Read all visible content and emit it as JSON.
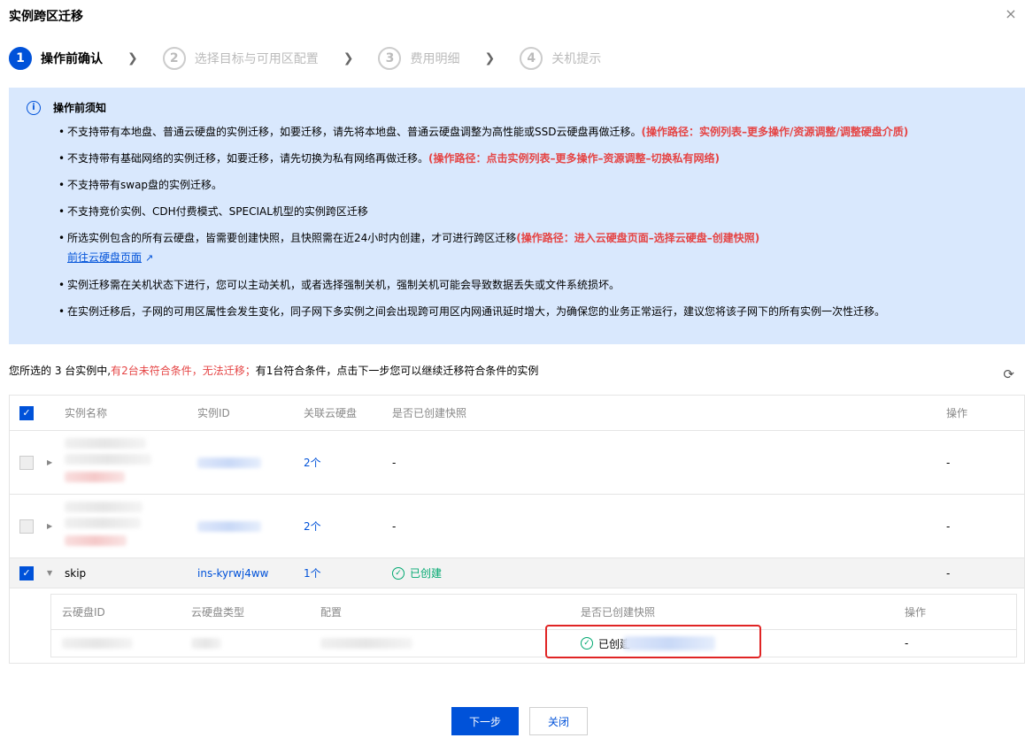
{
  "dialog": {
    "title": "实例跨区迁移",
    "close_icon": "×"
  },
  "steps": [
    {
      "num": "1",
      "label": "操作前确认"
    },
    {
      "num": "2",
      "label": "选择目标与可用区配置"
    },
    {
      "num": "3",
      "label": "费用明细"
    },
    {
      "num": "4",
      "label": "关机提示"
    }
  ],
  "notice": {
    "title": "操作前须知",
    "items": [
      {
        "text": "不支持带有本地盘、普通云硬盘的实例迁移，如要迁移，请先将本地盘、普通云硬盘调整为高性能或SSD云硬盘再做迁移。",
        "path": "(操作路径：实例列表–更多操作/资源调整/调整硬盘介质)"
      },
      {
        "text": "不支持带有基础网络的实例迁移，如要迁移，请先切换为私有网络再做迁移。",
        "path": "(操作路径：点击实例列表–更多操作–资源调整–切换私有网络)"
      },
      {
        "text": "不支持带有swap盘的实例迁移。",
        "path": ""
      },
      {
        "text": "不支持竞价实例、CDH付费模式、SPECIAL机型的实例跨区迁移",
        "path": ""
      },
      {
        "text": "所选实例包含的所有云硬盘，皆需要创建快照，且快照需在近24小时内创建，才可进行跨区迁移",
        "path": "(操作路径：进入云硬盘页面–选择云硬盘–创建快照)",
        "link": "前往云硬盘页面"
      },
      {
        "text": "实例迁移需在关机状态下进行，您可以主动关机，或者选择强制关机，强制关机可能会导致数据丢失或文件系统损坏。",
        "path": ""
      },
      {
        "text": "在实例迁移后，子网的可用区属性会发生变化，同子网下多实例之间会出现跨可用区内网通讯延时增大，为确保您的业务正常运行，建议您将该子网下的所有实例一次性迁移。",
        "path": ""
      }
    ]
  },
  "summary": {
    "prefix": "您所选的 3 台实例中,",
    "warn": "有2台未符合条件，无法迁移；",
    "suffix": "有1台符合条件，点击下一步您可以继续迁移符合条件的实例"
  },
  "table": {
    "headers": {
      "name": "实例名称",
      "id": "实例ID",
      "disk": "关联云硬盘",
      "snapshot": "是否已创建快照",
      "op": "操作"
    },
    "rows": [
      {
        "name": "",
        "id": "",
        "disk": "2个",
        "snapshot": "-",
        "op": "-",
        "checked": false
      },
      {
        "name": "",
        "id": "",
        "disk": "2个",
        "snapshot": "-",
        "op": "-",
        "checked": false
      },
      {
        "name": "skip",
        "id": "ins-kyrwj4ww",
        "disk": "1个",
        "snapshot": "已创建",
        "op": "-",
        "checked": true
      }
    ],
    "sub": {
      "headers": {
        "id": "云硬盘ID",
        "type": "云硬盘类型",
        "config": "配置",
        "snapshot": "是否已创建快照",
        "op": "操作"
      },
      "row": {
        "snapshot": "已创建",
        "op": "-"
      }
    }
  },
  "buttons": {
    "next": "下一步",
    "close": "关闭"
  },
  "colors": {
    "primary": "#0052d9",
    "notice_bg": "#d9e8fd",
    "danger": "#e54545",
    "success": "#00a870"
  }
}
